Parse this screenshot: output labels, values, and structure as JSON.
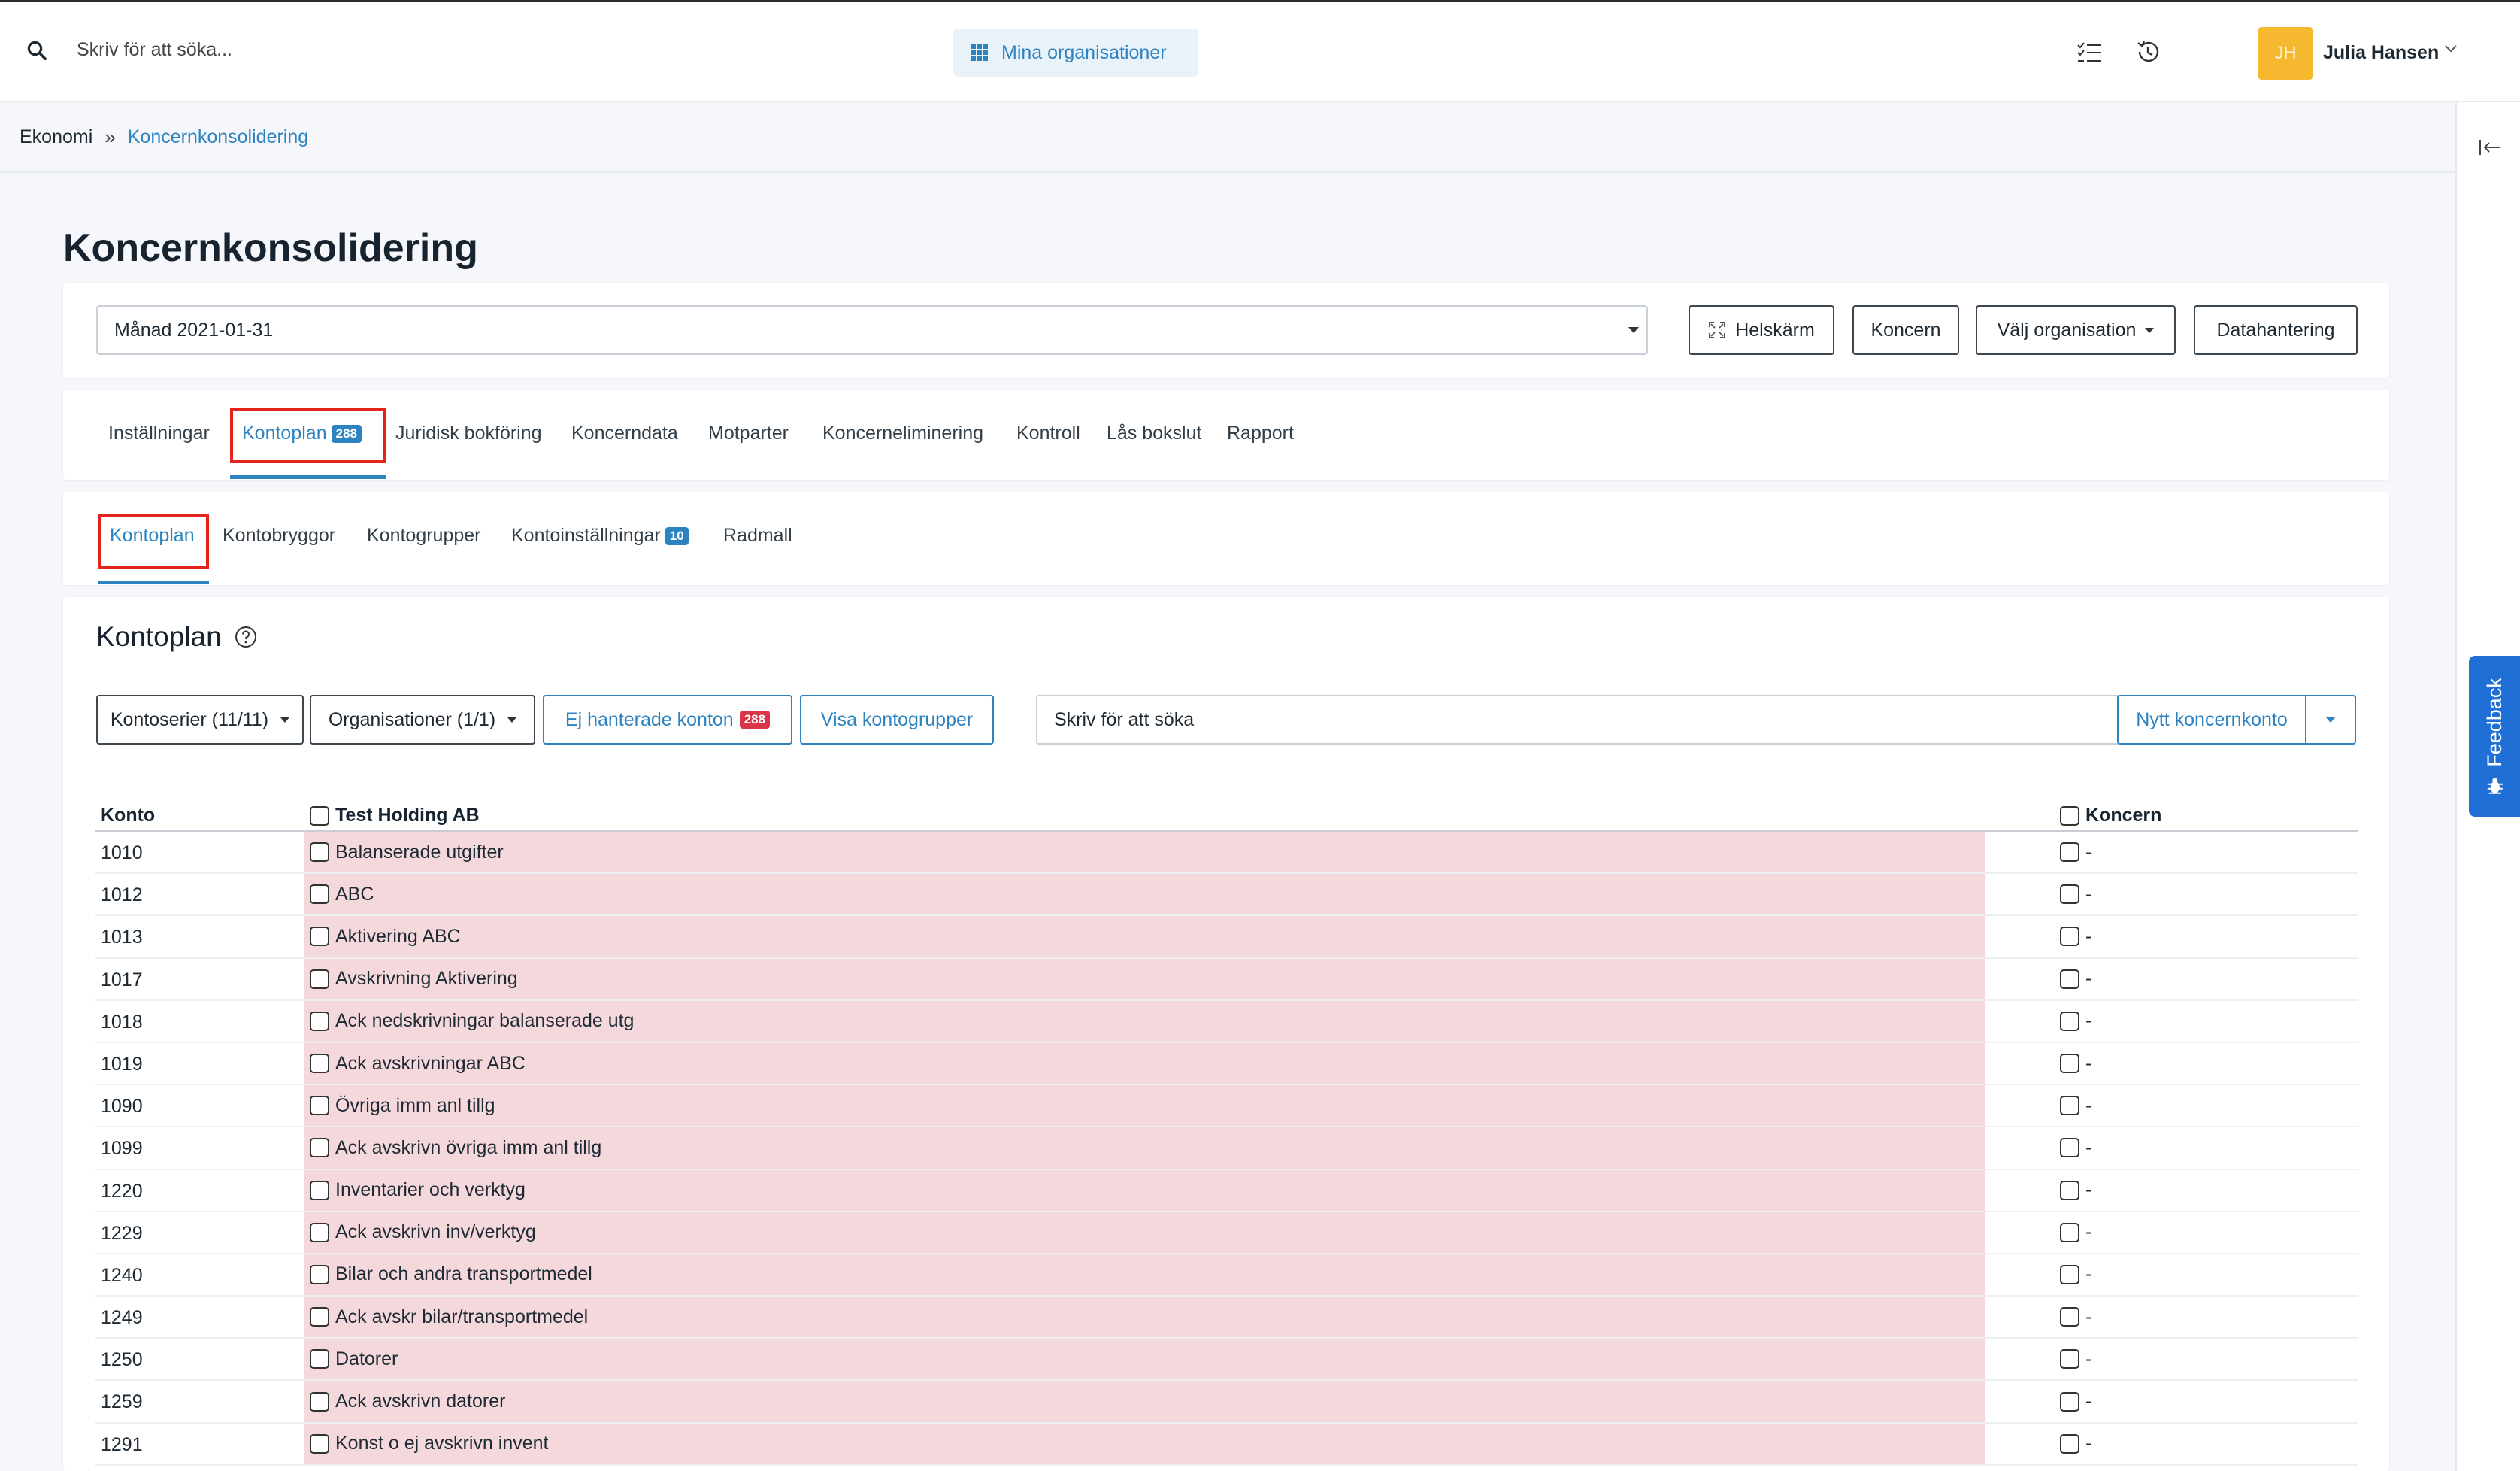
{
  "topbar": {
    "search_placeholder": "Skriv för att söka...",
    "org_button_label": "Mina organisationer",
    "avatar_initials": "JH",
    "user_name": "Julia Hansen",
    "avatar_color": "#f5b82e"
  },
  "breadcrumb": {
    "home": "Ekonomi",
    "separator": "»",
    "current": "Koncernkonsolidering"
  },
  "page": {
    "title": "Koncernkonsolidering"
  },
  "filter": {
    "period_value": "Månad 2021-01-31",
    "fullscreen_label": "Helskärm",
    "koncern_label": "Koncern",
    "choose_org_label": "Välj organisation",
    "data_label": "Datahantering"
  },
  "tabs": [
    {
      "label": "Inställningar"
    },
    {
      "label": "Kontoplan",
      "badge": "288"
    },
    {
      "label": "Juridisk bokföring"
    },
    {
      "label": "Koncerndata"
    },
    {
      "label": "Motparter"
    },
    {
      "label": "Koncerneliminering"
    },
    {
      "label": "Kontroll"
    },
    {
      "label": "Lås bokslut"
    },
    {
      "label": "Rapport"
    }
  ],
  "subtabs": [
    {
      "label": "Kontoplan"
    },
    {
      "label": "Kontobryggor"
    },
    {
      "label": "Kontogrupper"
    },
    {
      "label": "Kontoinställningar",
      "badge": "10"
    },
    {
      "label": "Radmall"
    }
  ],
  "section": {
    "title": "Kontoplan",
    "series_label": "Kontoserier (11/11)",
    "orgs_label": "Organisationer (1/1)",
    "unhandled_label": "Ej hanterade konton",
    "unhandled_badge": "288",
    "show_groups_label": "Visa kontogrupper",
    "search_placeholder": "Skriv för att söka",
    "new_account_label": "Nytt koncernkonto"
  },
  "table": {
    "headers": {
      "konto": "Konto",
      "org": "Test Holding AB",
      "koncern": "Koncern"
    },
    "rows": [
      {
        "konto": "1010",
        "name": "Balanserade utgifter",
        "koncern": "-"
      },
      {
        "konto": "1012",
        "name": "ABC",
        "koncern": "-"
      },
      {
        "konto": "1013",
        "name": "Aktivering ABC",
        "koncern": "-"
      },
      {
        "konto": "1017",
        "name": "Avskrivning Aktivering",
        "koncern": "-"
      },
      {
        "konto": "1018",
        "name": "Ack nedskrivningar balanserade utg",
        "koncern": "-"
      },
      {
        "konto": "1019",
        "name": "Ack avskrivningar ABC",
        "koncern": "-"
      },
      {
        "konto": "1090",
        "name": "Övriga imm anl tillg",
        "koncern": "-"
      },
      {
        "konto": "1099",
        "name": "Ack avskrivn övriga imm anl tillg",
        "koncern": "-"
      },
      {
        "konto": "1220",
        "name": "Inventarier och verktyg",
        "koncern": "-"
      },
      {
        "konto": "1229",
        "name": "Ack avskrivn inv/verktyg",
        "koncern": "-"
      },
      {
        "konto": "1240",
        "name": "Bilar och andra transportmedel",
        "koncern": "-"
      },
      {
        "konto": "1249",
        "name": "Ack avskr bilar/transportmedel",
        "koncern": "-"
      },
      {
        "konto": "1250",
        "name": "Datorer",
        "koncern": "-"
      },
      {
        "konto": "1259",
        "name": "Ack avskrivn datorer",
        "koncern": "-"
      },
      {
        "konto": "1291",
        "name": "Konst o ej avskrivn invent",
        "koncern": "-"
      }
    ]
  },
  "feedback": {
    "label": "Feedback"
  },
  "colors": {
    "accent": "#2d83c0",
    "highlight_box": "#e2241c",
    "badge_red": "#d93547",
    "unmapped_row": "#f5d8dc",
    "feedback_bg": "#1f6fd6"
  }
}
